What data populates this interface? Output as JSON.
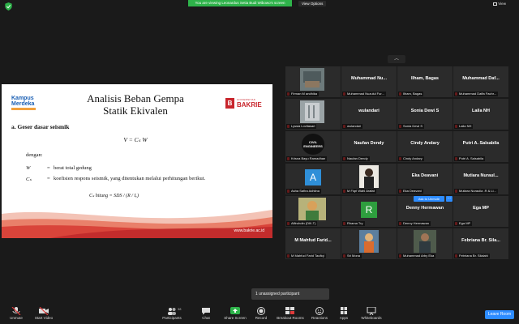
{
  "top_bar": {
    "banner": "You are viewing Leonardus Setia Budi Wibowo's screen",
    "view_options": "View Options",
    "view": "View"
  },
  "slide": {
    "logo_left_line1": "Kampus",
    "logo_left_line2": "Merdeka",
    "title_line1": "Analisis Beban Gempa",
    "title_line2": "Statik Ekivalen",
    "logo_right_small": "UNIVERSITAS",
    "logo_right_big": "BAKRIE",
    "logo_right_mark": "B",
    "section": "a. Geser dasar seismik",
    "formula": "V = Cₛ W",
    "dengan": "dengan:",
    "defs": [
      {
        "sym": "W",
        "eq": "=",
        "desc": "berat total gedung"
      },
      {
        "sym": "Cₛ",
        "eq": "=",
        "desc": "koefisien respons seismik, yang ditentukan melalui perhitungan berikut."
      }
    ],
    "formula2": "Cₛ hitung = SDS / (R / Iₑ)",
    "website": "www.bakrie.ac.id"
  },
  "gallery": {
    "tiles": [
      {
        "name": "",
        "label": "Firman M andhika"
      },
      {
        "name": "Muhammad Nu...",
        "label": "Muhammad Nuzulul Fur..."
      },
      {
        "name": "Ilham, Bagas",
        "label": "Ilham, Bagas"
      },
      {
        "name": "Muhammad Daf...",
        "label": "Muhammad Daffa Fachr..."
      },
      {
        "name": "",
        "label": "Lyssia Lovitasari"
      },
      {
        "name": "wulandari",
        "label": "wulandari"
      },
      {
        "name": "Sonia Dewi S",
        "label": "Sonia Dewi S"
      },
      {
        "name": "Laila NH",
        "label": "Laila NH"
      },
      {
        "name": "",
        "label": "Krisna Bayu Ramadhan"
      },
      {
        "name": "Naufan Dendy",
        "label": "Naufan Dendy"
      },
      {
        "name": "Cindy Andary",
        "label": "Cindy Andary"
      },
      {
        "name": "Putri A. Salsabila",
        "label": "Putri A. Salsabila"
      },
      {
        "name": "",
        "label": "Asha Safira Adhlina"
      },
      {
        "name": "",
        "label": "M Fiqri Wahl Arafat"
      },
      {
        "name": "Eka Deavani",
        "label": "Eka Deavani"
      },
      {
        "name": "Mutiara Nuraul...",
        "label": "Mutiara Nuraulia .R & Li..."
      },
      {
        "name": "",
        "label": "Alfiruhdin (DIII-T)"
      },
      {
        "name": "",
        "label": "Rhama Try"
      },
      {
        "name": "Denny Hermawan",
        "label": "Denny Hermawan"
      },
      {
        "name": "Ega MP",
        "label": "Ega MP"
      },
      {
        "name": "M Mahfud Farid...",
        "label": "M Mahfud Farid Taufiqi"
      },
      {
        "name": "",
        "label": "Sri Mona"
      },
      {
        "name": "",
        "label": "Muhammad Arby Eka"
      },
      {
        "name": "Febriana Br. Sila...",
        "label": "Febriana Br. Silalahi"
      }
    ],
    "avatar_A": "A",
    "avatar_R": "R",
    "civil_text": "CIVIL ENGINEERS",
    "ask_unmute": "Ask to Unmute",
    "more": "..."
  },
  "unassigned": "1 unassigned participant",
  "toolbar": {
    "unmute": "Unmute",
    "start_video": "Start Video",
    "participants": "Participants",
    "participants_count": "38",
    "chat": "Chat",
    "share_screen": "Share Screen",
    "record": "Record",
    "breakout_rooms": "Breakout Rooms",
    "reactions": "Reactions",
    "apps": "Apps",
    "whiteboards": "Whiteboards",
    "leave_room": "Leave Room"
  },
  "colors": {
    "zoom_blue": "#2d8cff",
    "banner_green": "#2eb34a",
    "muted_red": "#e03b3b",
    "bakrie_red": "#c8252c"
  }
}
